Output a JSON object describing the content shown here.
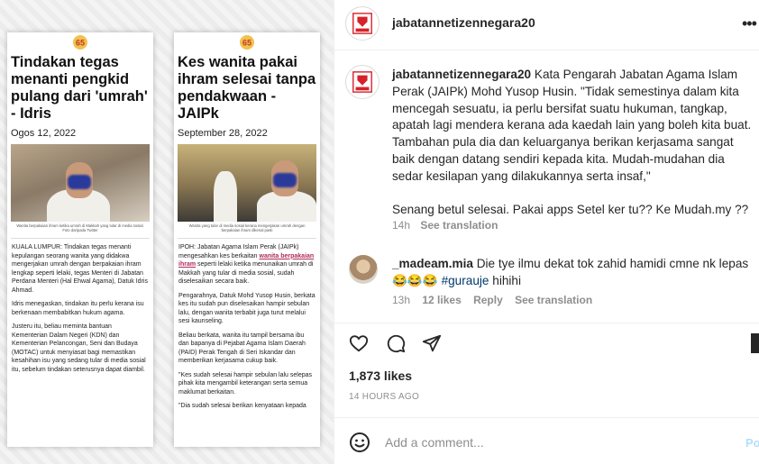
{
  "articles": [
    {
      "title": "Tindakan tegas menanti pengkid pulang dari 'umrah' - Idris",
      "date": "Ogos 12, 2022",
      "photo_caption": "Wanita berpakaian ihram ketika umrah di Makkah yang tular di media sosial. Foto daripada Twitter",
      "paragraphs": [
        "KUALA LUMPUR: Tindakan tegas menanti kepulangan seorang wanita yang didakwa mengerjakan umrah dengan berpakaian ihram lengkap seperti lelaki, tegas Menteri di Jabatan Perdana Menteri (Hal Ehwal Agama), Datuk Idris Ahmad.",
        "Idris menegaskan, tindakan itu perlu kerana isu berkenaan membabitkan hukum agama.",
        "Justeru itu, beliau meminta bantuan Kementerian Dalam Negeri (KDN) dan Kementerian Pelancongan, Seni dan Budaya (MOTAC) untuk menyiasat bagi memastikan kesahihan isu yang sedang tular di media sosial itu, sebelum tindakan seterusnya dapat diambil."
      ]
    },
    {
      "title": "Kes wanita pakai ihram selesai tanpa pendakwaan - JAIPk",
      "date": "September 28, 2022",
      "photo_caption": "Wanita yang tular di media sosial kerana mengerjakan umrah dengan berpakaian ihram dikenal pasti",
      "p1_before": "IPOH: Jabatan Agama Islam Perak (JAIPk) mengesahkan kes berkaitan ",
      "p1_link": "wanita berpakaian ihram",
      "p1_after": " seperti lelaki ketika menunaikan umrah di Makkah yang tular di media sosial, sudah diselesaikan secara baik.",
      "paragraphs": [
        "Pengarahnya, Datuk Mohd Yusop Husin, berkata kes itu sudah pun diselesaikan hampir sebulan lalu, dengan wanita terbabit juga turut melalui sesi kaunseling.",
        "Beliau berkata, wanita itu tampil bersama ibu dan bapanya di Pejabat Agama Islam Daerah (PAID) Perak Tengah di Seri Iskandar dan memberikan kerjasama cukup baik.",
        "\"Kes sudah selesai hampir sebulan lalu selepas pihak kita mengambil keterangan serta semua maklumat berkaitan.",
        "\"Dia sudah selesai berikan kenyataan kepada"
      ]
    }
  ],
  "post": {
    "username": "jabatannetizennegara20",
    "caption_text": "Kata Pengarah Jabatan Agama Islam Perak (JAIPk) Mohd Yusop Husin. \"Tidak semestinya dalam kita mencegah sesuatu, ia perlu bersifat suatu hukuman, tangkap, apatah lagi mendera kerana ada kaedah lain yang boleh kita buat. Tambahan pula dia dan keluarganya berikan kerjasama sangat baik dengan datang sendiri kepada kita. Mudah-mudahan dia sedar kesilapan yang dilakukannya serta insaf,\"",
    "caption_extra": "Senang betul selesai. Pakai apps Setel ker tu?? Ke Mudah.my ??",
    "caption_time": "14h",
    "see_translation": "See translation",
    "likes": "1,873 likes",
    "time_ago": "14 HOURS AGO",
    "add_comment_placeholder": "Add a comment...",
    "post_button": "Post"
  },
  "comment": {
    "username": "_madeam.mia",
    "text": "Die tye ilmu dekat tok zahid hamidi cmne nk lepas😂😂😂",
    "hashtag": "#gurauje",
    "text_after": " hihihi",
    "time": "13h",
    "likes": "12 likes",
    "reply": "Reply",
    "see_translation": "See translation"
  },
  "colors": {
    "accent_link": "#00376b",
    "muted": "#8e8e8e",
    "brand_red": "#d6222a"
  }
}
